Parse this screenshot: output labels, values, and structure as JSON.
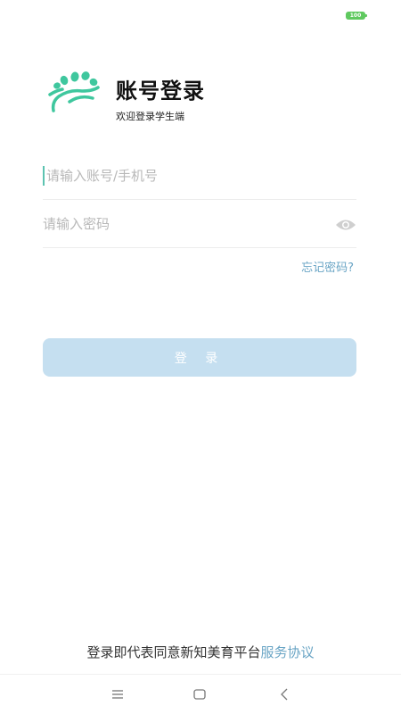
{
  "status_bar": {
    "battery": "100",
    "battery_color": "#5fc95f"
  },
  "header": {
    "title": "账号登录",
    "subtitle": "欢迎登录学生端",
    "logo_icon": "brand-logo-icon",
    "logo_color": "#3fc79e"
  },
  "form": {
    "account": {
      "placeholder": "请输入账号/手机号",
      "value": ""
    },
    "password": {
      "placeholder": "请输入密码",
      "value": ""
    },
    "eye_icon": "eye-icon",
    "forgot_label": "忘记密码?",
    "login_label": "登 录"
  },
  "footer": {
    "agreement_text": "登录即代表同意新知美育平台",
    "agreement_link": "服务协议"
  },
  "nav_bar": {
    "menu_icon": "menu-icon",
    "home_icon": "home-icon",
    "back_icon": "back-icon"
  },
  "colors": {
    "accent": "#6aa5c5",
    "button_bg": "#c5dff0",
    "cursor": "#5cc3b0"
  }
}
